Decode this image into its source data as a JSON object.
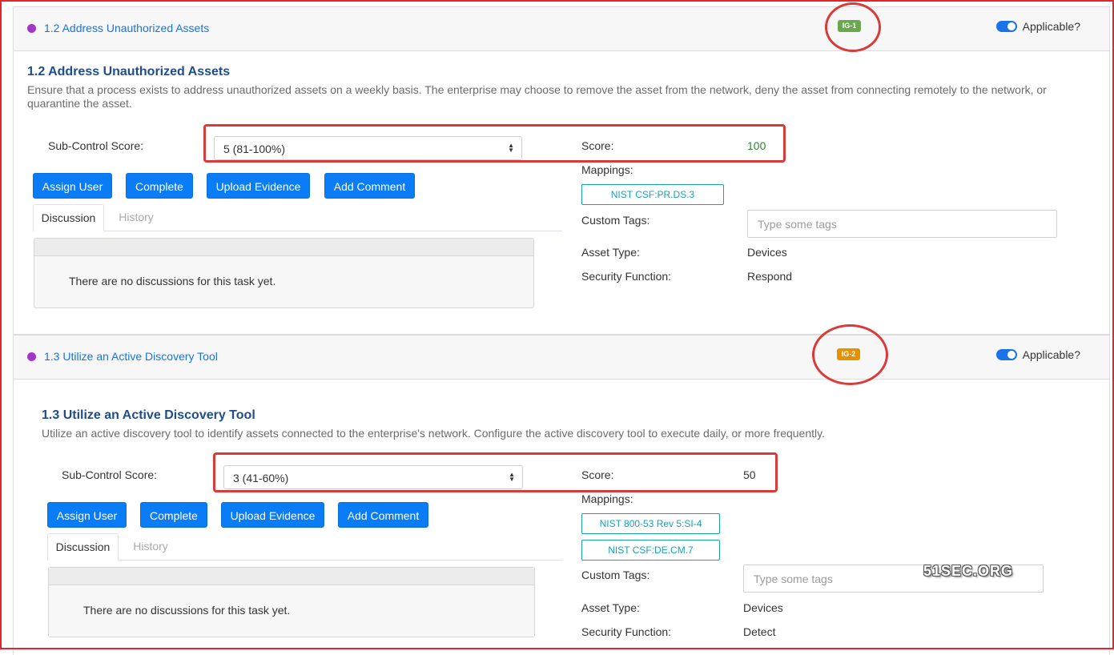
{
  "controls": [
    {
      "header_title": "1.2 Address Unauthorized Assets",
      "ig_label": "IG-1",
      "ig_color": "#6aa84f",
      "applicable_label": "Applicable?",
      "title": "1.2 Address Unauthorized Assets",
      "description": "Ensure that a process exists to address unauthorized assets on a weekly basis. The enterprise may choose to remove the asset from the network, deny the asset from connecting remotely to the network, or quarantine the asset.",
      "subcontrol_label": "Sub-Control Score:",
      "subcontrol_value": "5 (81-100%)",
      "score_label": "Score:",
      "score_value": "100",
      "score_color": "#2e8b2e",
      "mappings_label": "Mappings:",
      "mappings": [
        "NIST CSF:PR.DS.3"
      ],
      "custom_tags_label": "Custom Tags:",
      "tags_placeholder": "Type some tags",
      "asset_type_label": "Asset Type:",
      "asset_type_value": "Devices",
      "security_function_label": "Security Function:",
      "security_function_value": "Respond",
      "buttons": {
        "assign": "Assign User",
        "complete": "Complete",
        "upload": "Upload Evidence",
        "comment": "Add Comment"
      },
      "tabs": {
        "discussion": "Discussion",
        "history": "History"
      },
      "empty_discussion": "There are no discussions for this task yet."
    },
    {
      "header_title": "1.3 Utilize an Active Discovery Tool",
      "ig_label": "IG-2",
      "ig_color": "#e69100",
      "applicable_label": "Applicable?",
      "title": "1.3 Utilize an Active Discovery Tool",
      "description": "Utilize an active discovery tool to identify assets connected to the enterprise's network. Configure the active discovery tool to execute daily, or more frequently.",
      "subcontrol_label": "Sub-Control Score:",
      "subcontrol_value": "3 (41-60%)",
      "score_label": "Score:",
      "score_value": "50",
      "score_color": "#333333",
      "mappings_label": "Mappings:",
      "mappings": [
        "NIST 800-53 Rev 5:SI-4",
        "NIST CSF:DE.CM.7"
      ],
      "custom_tags_label": "Custom Tags:",
      "tags_placeholder": "Type some tags",
      "asset_type_label": "Asset Type:",
      "asset_type_value": "Devices",
      "security_function_label": "Security Function:",
      "security_function_value": "Detect",
      "buttons": {
        "assign": "Assign User",
        "complete": "Complete",
        "upload": "Upload Evidence",
        "comment": "Add Comment"
      },
      "tabs": {
        "discussion": "Discussion",
        "history": "History"
      },
      "empty_discussion": "There are no discussions for this task yet."
    }
  ],
  "watermark": "51SEC.ORG"
}
